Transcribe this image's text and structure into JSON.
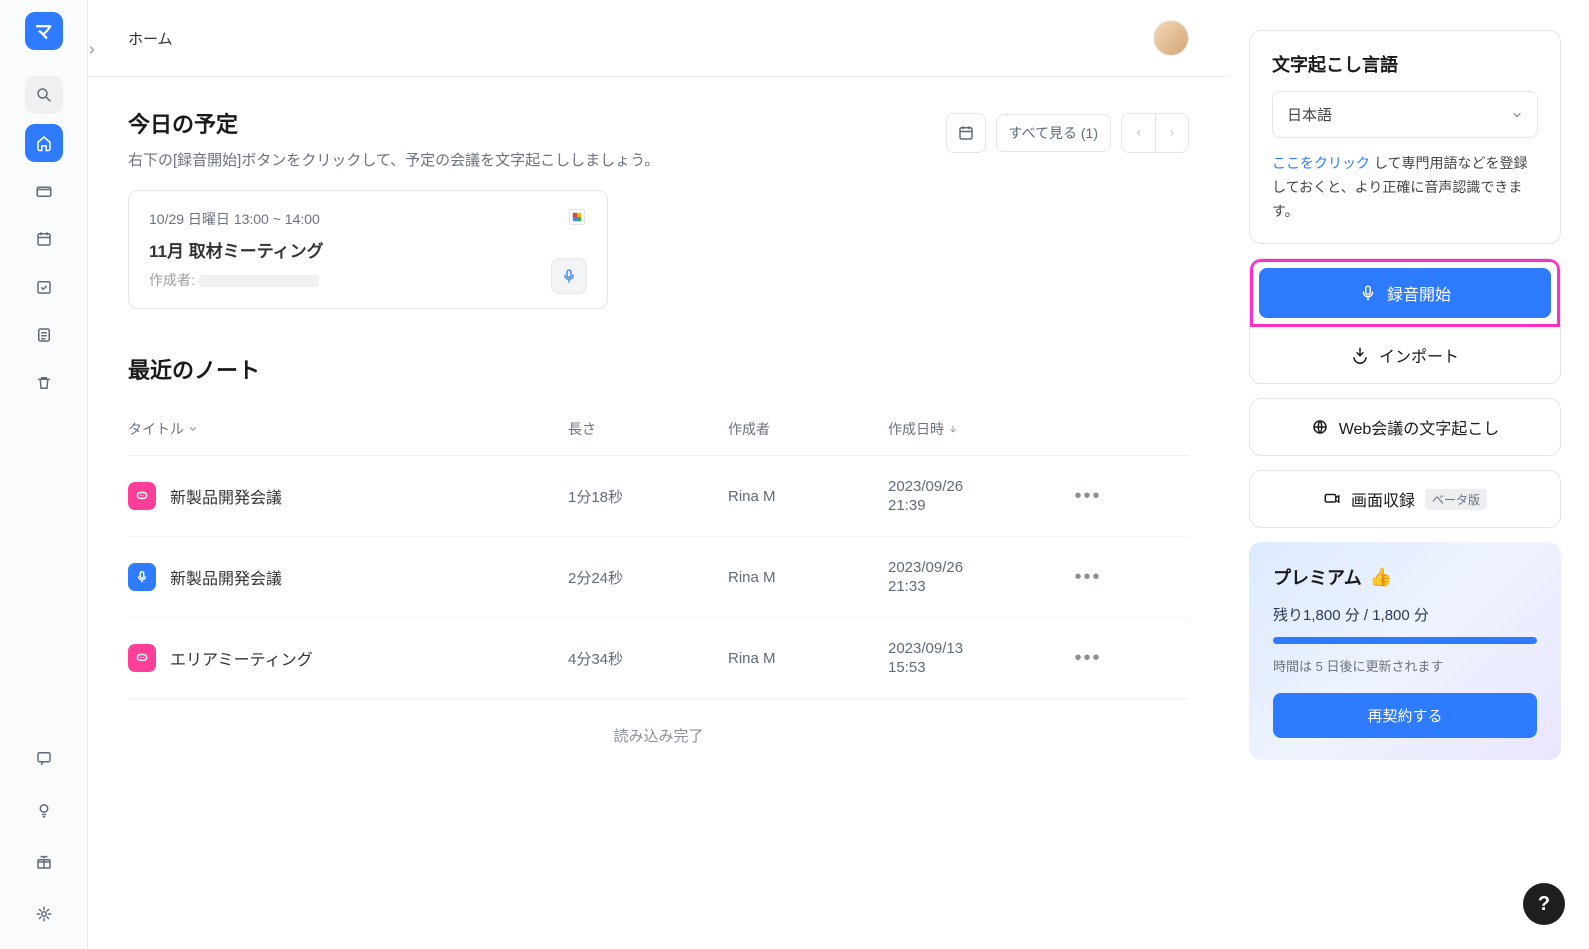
{
  "header": {
    "title": "ホーム"
  },
  "today": {
    "title": "今日の予定",
    "subtitle": "右下の[録音開始]ボタンをクリックして、予定の会議を文字起こししましょう。",
    "see_all": "すべて見る (1)"
  },
  "event": {
    "datetime": "10/29 日曜日 13:00 ~ 14:00",
    "title": "11月 取材ミーティング",
    "creator_label": "作成者:"
  },
  "recent": {
    "title": "最近のノート",
    "col_title": "タイトル",
    "col_length": "長さ",
    "col_author": "作成者",
    "col_created": "作成日時",
    "load_done": "読み込み完了",
    "rows": [
      {
        "icon": "pink",
        "title": "新製品開発会議",
        "length": "1分18秒",
        "author": "Rina M",
        "date": "2023/09/26",
        "time": "21:39"
      },
      {
        "icon": "blue",
        "title": "新製品開発会議",
        "length": "2分24秒",
        "author": "Rina M",
        "date": "2023/09/26",
        "time": "21:33"
      },
      {
        "icon": "pink",
        "title": "エリアミーティング",
        "length": "4分34秒",
        "author": "Rina M",
        "date": "2023/09/13",
        "time": "15:53"
      }
    ]
  },
  "lang_panel": {
    "title": "文字起こし言語",
    "selected": "日本語",
    "hint_link": "ここをクリック",
    "hint_rest": " して専門用語などを登録しておくと、より正確に音声認識できます。"
  },
  "actions": {
    "record": "録音開始",
    "import": "インポート",
    "web_meeting": "Web会議の文字起こし",
    "screen_capture": "画面収録",
    "beta": "ベータ版"
  },
  "premium": {
    "title": "プレミアム",
    "minutes": "残り1,800 分 / 1,800 分",
    "note": "時間は 5 日後に更新されます",
    "renew": "再契約する"
  },
  "logo_text": "マ"
}
